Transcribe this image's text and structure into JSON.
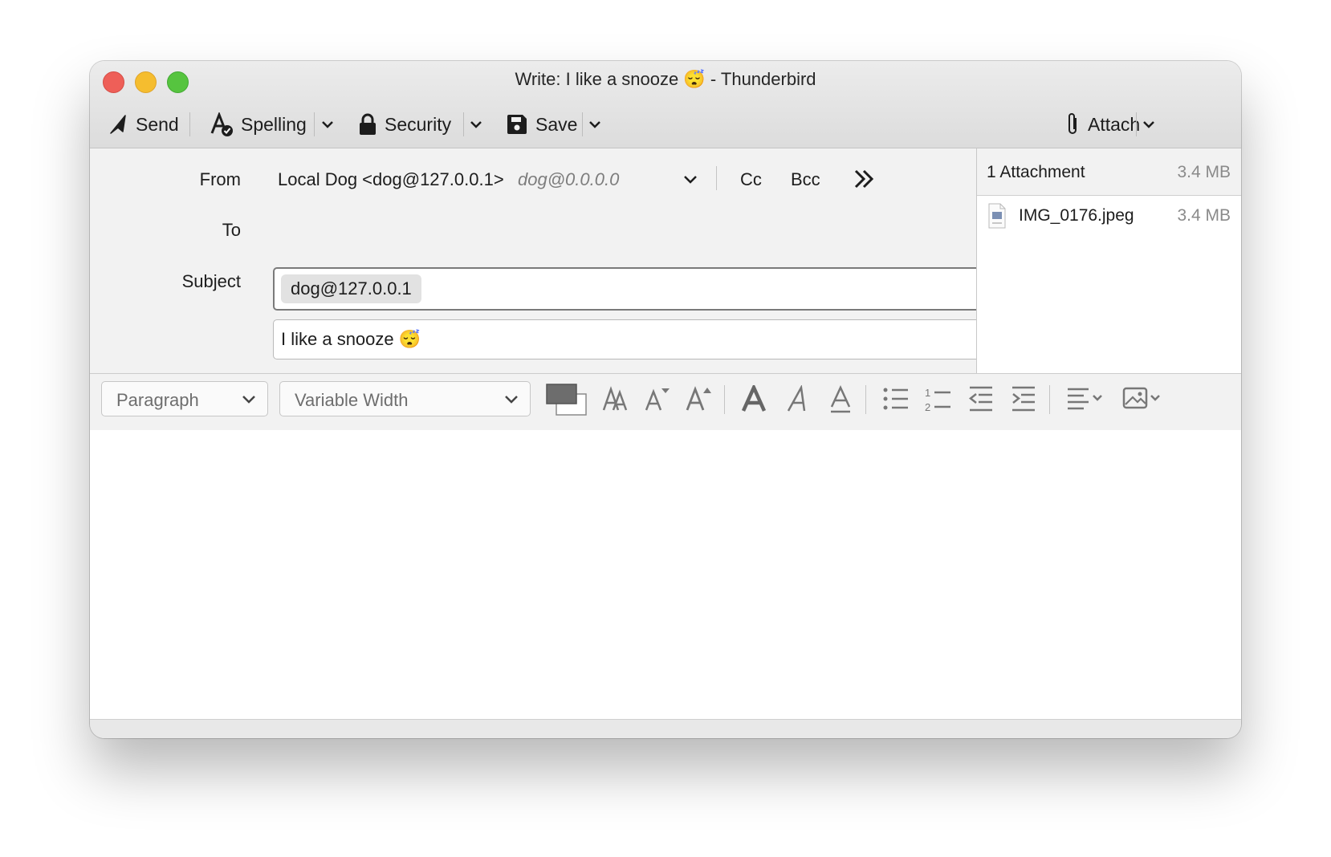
{
  "window": {
    "title": "Write: I like a snooze 😴 - Thunderbird"
  },
  "toolbar": {
    "send_label": "Send",
    "spelling_label": "Spelling",
    "security_label": "Security",
    "save_label": "Save",
    "attach_label": "Attach"
  },
  "headers": {
    "from_label": "From",
    "from_identity": "Local Dog <dog@127.0.0.1>",
    "from_alias": "dog@0.0.0.0",
    "cc_label": "Cc",
    "bcc_label": "Bcc",
    "to_label": "To",
    "to_recipients": [
      "dog@127.0.0.1"
    ],
    "subject_label": "Subject",
    "subject_value": "I like a snooze 😴"
  },
  "attachments": {
    "count_label": "1 Attachment",
    "total_size": "3.4 MB",
    "items": [
      {
        "name": "IMG_0176.jpeg",
        "size": "3.4 MB",
        "icon": "jpeg-file-icon"
      }
    ]
  },
  "format": {
    "paragraph_format": "Paragraph",
    "font_family": "Variable Width"
  },
  "colors": {
    "close": "#ee5f58",
    "minimize": "#f5bd2f",
    "maximize": "#56c43f"
  }
}
